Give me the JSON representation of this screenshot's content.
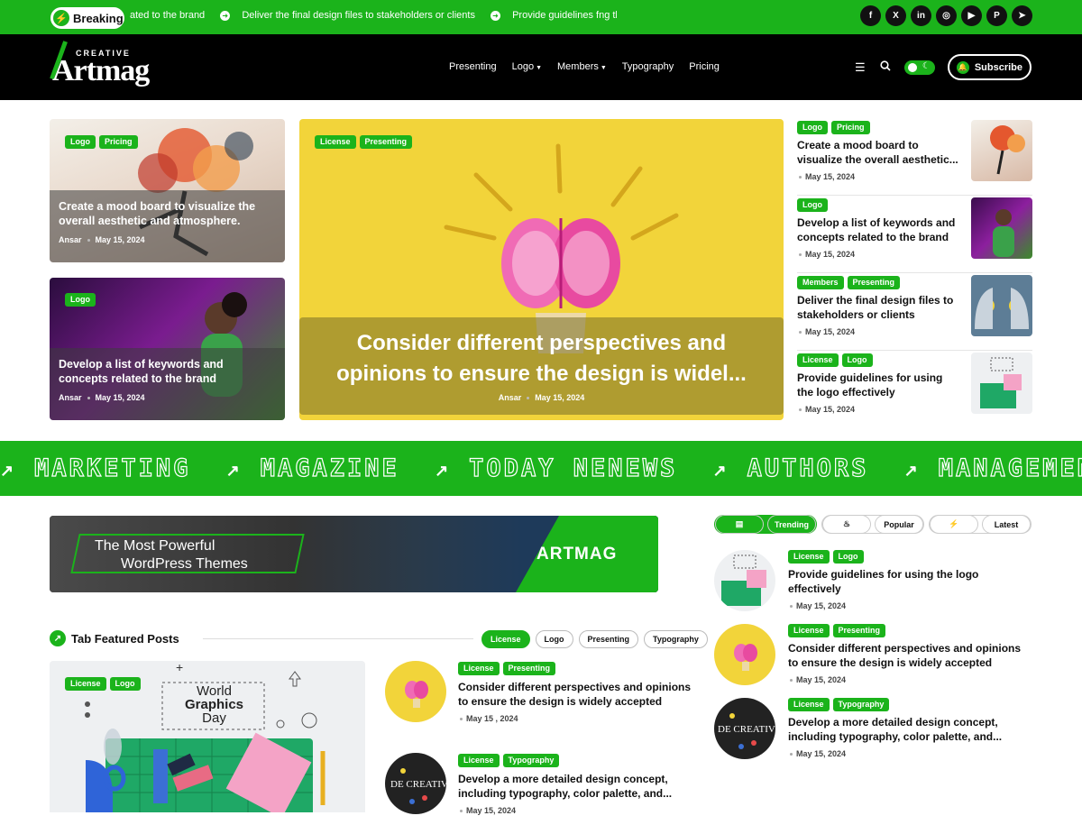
{
  "topbar": {
    "breaking_label": "Breaking",
    "ticker": [
      "ated to the brand",
      "Deliver the final design files to stakeholders or clients",
      "Provide guidelines fng the l"
    ],
    "socials": [
      "facebook-icon",
      "x-icon",
      "linkedin-icon",
      "instagram-icon",
      "youtube-icon",
      "pinterest-icon",
      "telegram-icon"
    ]
  },
  "nav": {
    "logo_small": "CREATIVE",
    "logo_big": "Artmag",
    "menu": [
      {
        "label": "Presenting",
        "dropdown": false
      },
      {
        "label": "Logo",
        "dropdown": true
      },
      {
        "label": "Members",
        "dropdown": true
      },
      {
        "label": "Typography",
        "dropdown": false
      },
      {
        "label": "Pricing",
        "dropdown": false
      }
    ],
    "subscribe": "Subscribe"
  },
  "hero": {
    "left_cards": [
      {
        "tags": [
          "Logo",
          "Pricing"
        ],
        "title": "Create a mood board to visualize the overall aesthetic and atmosphere.",
        "author": "Ansar",
        "date": "May 15, 2024"
      },
      {
        "tags": [
          "Logo"
        ],
        "title": "Develop a list of keywords and concepts related to the brand",
        "author": "Ansar",
        "date": "May 15, 2024"
      }
    ],
    "center": {
      "tags": [
        "License",
        "Presenting"
      ],
      "title": "Consider different perspectives and opinions to ensure the design is widel...",
      "author": "Ansar",
      "date": "May 15, 2024"
    },
    "side_list": [
      {
        "tags": [
          "Logo",
          "Pricing"
        ],
        "title": "Create a mood board to visualize the overall aesthetic...",
        "date": "May 15, 2024"
      },
      {
        "tags": [
          "Logo"
        ],
        "title": "Develop a list of keywords and concepts related to the brand",
        "date": "May 15, 2024"
      },
      {
        "tags": [
          "Members",
          "Presenting"
        ],
        "title": "Deliver the final design files to stakeholders or clients",
        "date": "May 15, 2024"
      },
      {
        "tags": [
          "License",
          "Logo"
        ],
        "title": "Provide guidelines for using the logo effectively",
        "date": "May 15, 2024"
      }
    ]
  },
  "marquee": [
    "MARKETING",
    "MAGAZINE",
    "TODAY NENEWS",
    "AUTHORS",
    "MANAGEMENT"
  ],
  "banner": {
    "line1": "The Most Powerful",
    "line2": "WordPress Themes",
    "brand": "ARTMAG"
  },
  "tab_section": {
    "title": "Tab Featured Posts",
    "tabs": [
      "License",
      "Logo",
      "Presenting",
      "Typography"
    ],
    "active_tab": "License",
    "featured_tags": [
      "License",
      "Logo"
    ],
    "featured_card_text": [
      "World",
      "Graphics",
      "Day"
    ],
    "posts": [
      {
        "tags": [
          "License",
          "Presenting"
        ],
        "title": "Consider different perspectives and opinions to ensure the design is widely accepted",
        "date": "May 15 , 2024"
      },
      {
        "tags": [
          "License",
          "Typography"
        ],
        "title": "Develop a more detailed design concept, including typography, color palette, and...",
        "date": "May 15, 2024"
      }
    ]
  },
  "trending": {
    "tabs": [
      {
        "label": "Trending",
        "icon": "chart-icon"
      },
      {
        "label": "Popular",
        "icon": "fire-icon"
      },
      {
        "label": "Latest",
        "icon": "bolt-icon"
      }
    ],
    "posts": [
      {
        "tags": [
          "License",
          "Logo"
        ],
        "title": "Provide guidelines for using the logo effectively",
        "date": "May 15, 2024"
      },
      {
        "tags": [
          "License",
          "Presenting"
        ],
        "title": "Consider different perspectives and opinions to ensure the design is widely accepted",
        "date": "May 15, 2024"
      },
      {
        "tags": [
          "License",
          "Typography"
        ],
        "title": "Develop a more detailed design concept, including typography, color palette, and...",
        "date": "May 15, 2024"
      }
    ]
  },
  "colors": {
    "accent": "#1bb31b",
    "dark": "#000000",
    "hero_yellow": "#f2d43a"
  }
}
